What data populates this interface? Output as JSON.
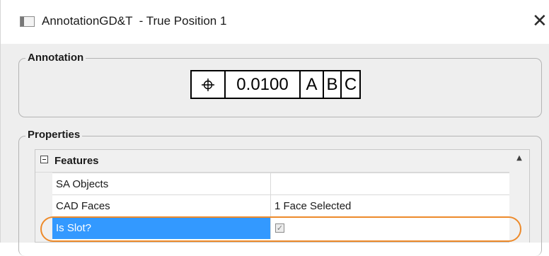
{
  "window": {
    "title": "AnnotationGD&T  - True Position 1",
    "app_icon": "window-app-icon",
    "close_glyph": "✕"
  },
  "annotation": {
    "group_label": "Annotation",
    "feature_control_frame": {
      "symbol_icon": "true-position-icon",
      "tolerance": "0.0100",
      "datums": [
        "A",
        "B",
        "C"
      ]
    }
  },
  "properties": {
    "group_label": "Properties",
    "category": {
      "label": "Features",
      "expanded": true,
      "expander_icon": "collapse-minus-icon"
    },
    "rows": [
      {
        "name": "SA Objects",
        "value": ""
      },
      {
        "name": "CAD Faces",
        "value": "1 Face Selected"
      },
      {
        "name": "Is Slot?",
        "checked": true,
        "selected": true
      }
    ],
    "scroll_up_glyph": "▲"
  },
  "colors": {
    "selection": "#3399ff",
    "highlight_ring": "#ed8a2a",
    "group_background": "#eeeeee"
  }
}
